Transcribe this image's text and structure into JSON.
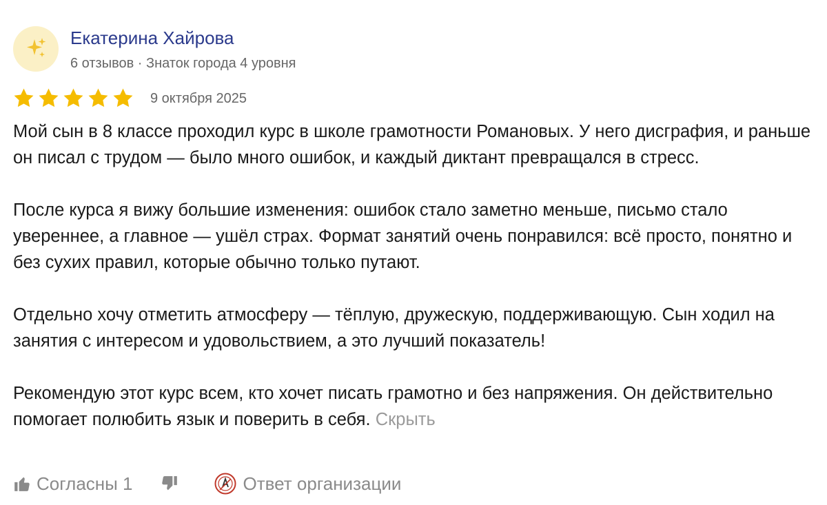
{
  "author": {
    "name": "Екатерина Хайрова",
    "meta": "6 отзывов · Знаток города 4 уровня",
    "avatar_icon": "sparkles-icon"
  },
  "rating": {
    "stars": 5,
    "max": 5,
    "color": "#f5bc00",
    "date": "9 октября 2025"
  },
  "review": {
    "paragraphs": [
      "Мой сын в 8 классе проходил курс в школе грамотности Романовых. У него дисграфия, и раньше он писал с трудом — было много ошибок, и каждый диктант превращался в стресс.",
      "После курса я вижу большие изменения: ошибок стало заметно меньше, письмо стало увереннее, а главное — ушёл страх. Формат занятий очень понравился: всё просто, понятно и без сухих правил, которые обычно только путают.",
      "Отдельно хочу отметить атмосферу — тёплую, дружескую, поддерживающую. Сын ходил на занятия с интересом и удовольствием, а это лучший показатель!",
      "Рекомендую этот курс всем, кто хочет писать грамотно и без напряжения. Он действительно помогает полюбить язык и поверить в себя."
    ],
    "collapse_label": "Скрыть"
  },
  "footer": {
    "like_label": "Согласны 1",
    "like_icon": "thumbs-up-icon",
    "dislike_icon": "thumbs-down-icon",
    "org_reply_label": "Ответ организации",
    "org_logo_icon": "organization-logo-icon"
  }
}
